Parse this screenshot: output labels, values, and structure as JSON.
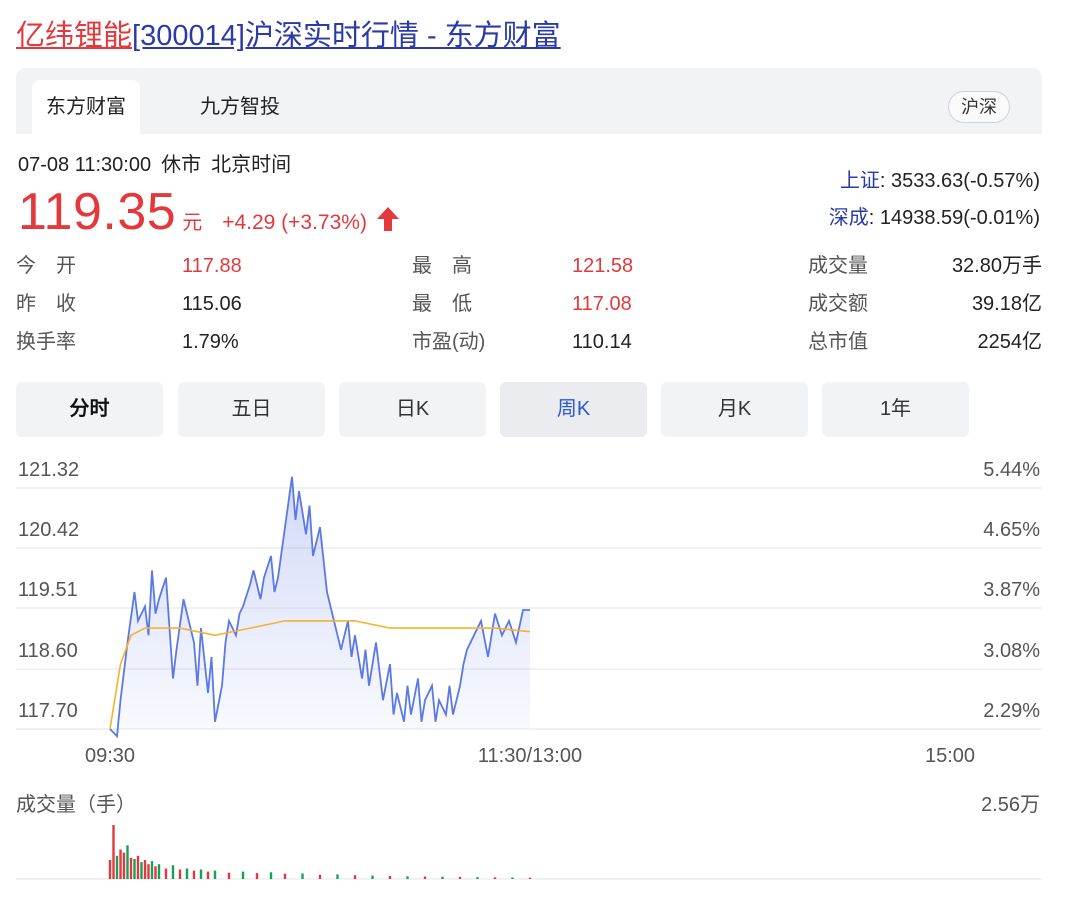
{
  "page_title": {
    "name": "亿纬锂能",
    "rest": "[300014]沪深实时行情 - 东方财富"
  },
  "tabs": [
    {
      "label": "东方财富",
      "active": true
    },
    {
      "label": "九方智投",
      "active": false
    }
  ],
  "market_badge": "沪深",
  "status": {
    "datetime": "07-08 11:30:00",
    "state": "休市",
    "timezone": "北京时间"
  },
  "price": {
    "value": "119.35",
    "unit": "元",
    "change": "+4.29 (+3.73%)",
    "direction": "up"
  },
  "indices": [
    {
      "label": "上证",
      "value": ": 3533.63(-0.57%)"
    },
    {
      "label": "深成",
      "value": ": 14938.59(-0.01%)"
    }
  ],
  "stats": [
    [
      {
        "label": "今　开",
        "value": "117.88",
        "red": true
      },
      {
        "label": "最　高",
        "value": "121.58",
        "red": true
      },
      {
        "label": "成交量",
        "value": "32.80万手",
        "red": false
      }
    ],
    [
      {
        "label": "昨　收",
        "value": "115.06",
        "red": false
      },
      {
        "label": "最　低",
        "value": "117.08",
        "red": true
      },
      {
        "label": "成交额",
        "value": "39.18亿",
        "red": false
      }
    ],
    [
      {
        "label": "换手率",
        "value": "1.79%",
        "red": false
      },
      {
        "label": "市盈(动)",
        "value": "110.14",
        "red": false
      },
      {
        "label": "总市值",
        "value": "2254亿",
        "red": false
      }
    ]
  ],
  "periods": [
    {
      "label": "分时",
      "state": "bold"
    },
    {
      "label": "五日",
      "state": ""
    },
    {
      "label": "日K",
      "state": ""
    },
    {
      "label": "周K",
      "state": "selected"
    },
    {
      "label": "月K",
      "state": ""
    },
    {
      "label": "1年",
      "state": ""
    }
  ],
  "volume_label": "成交量（手）",
  "volume_max_label": "2.56万",
  "colors": {
    "up": "#e4393c",
    "down": "#16a05d",
    "price_line": "#5b78e6",
    "avg_line": "#f5b230",
    "link": "#2b3aa8"
  },
  "chart_data": {
    "type": "line",
    "x_ticks": [
      "09:30",
      "11:30/13:00",
      "15:00"
    ],
    "y_left_ticks": [
      "121.32",
      "120.42",
      "119.51",
      "118.60",
      "117.70"
    ],
    "y_right_ticks": [
      "5.44%",
      "4.65%",
      "3.87%",
      "3.08%",
      "2.29%"
    ],
    "ylim": [
      117.7,
      121.32
    ],
    "x_total_minutes": 240,
    "series": [
      {
        "key": "price",
        "x": [
          0,
          2,
          3,
          5,
          7,
          8,
          10,
          11,
          12,
          13,
          14,
          16,
          17,
          18,
          19,
          21,
          22,
          24,
          25,
          26,
          28,
          29,
          30,
          32,
          33,
          34,
          36,
          37,
          38,
          40,
          41,
          43,
          44,
          46,
          47,
          48,
          50,
          52,
          53,
          54,
          56,
          57,
          58,
          60,
          62,
          64,
          65,
          66,
          68,
          69,
          70,
          72,
          73,
          74,
          76,
          77,
          78,
          80,
          81,
          82,
          84,
          85,
          86,
          88,
          89,
          90,
          92,
          93,
          94,
          96,
          97,
          98,
          100,
          101,
          102,
          104,
          106,
          108,
          110,
          112,
          114,
          116,
          118,
          120
        ],
        "values": [
          117.7,
          117.6,
          118.1,
          118.9,
          119.6,
          119.2,
          119.4,
          119.0,
          119.9,
          119.3,
          119.5,
          119.8,
          119.1,
          118.4,
          118.8,
          119.5,
          119.3,
          118.9,
          118.3,
          119.1,
          118.2,
          118.7,
          117.8,
          118.3,
          118.9,
          119.2,
          119.0,
          119.3,
          119.4,
          119.7,
          119.9,
          119.5,
          119.8,
          120.1,
          119.6,
          119.8,
          120.5,
          121.2,
          120.6,
          121.0,
          120.4,
          120.8,
          120.1,
          120.5,
          119.6,
          119.2,
          119.0,
          118.8,
          119.2,
          118.7,
          119.0,
          118.4,
          118.8,
          118.3,
          118.9,
          118.5,
          118.1,
          118.6,
          117.9,
          118.2,
          117.8,
          118.3,
          117.9,
          118.4,
          117.8,
          118.1,
          118.3,
          117.8,
          118.1,
          117.9,
          118.3,
          117.9,
          118.3,
          118.6,
          118.8,
          119.0,
          119.2,
          118.7,
          119.3,
          119.0,
          119.2,
          118.9,
          119.35,
          119.35
        ]
      },
      {
        "key": "avg",
        "x": [
          0,
          3,
          6,
          10,
          14,
          20,
          30,
          40,
          50,
          60,
          70,
          80,
          90,
          100,
          110,
          120
        ],
        "values": [
          117.7,
          118.6,
          119.0,
          119.1,
          119.1,
          119.1,
          119.0,
          119.1,
          119.2,
          119.2,
          119.2,
          119.1,
          119.1,
          119.1,
          119.1,
          119.05
        ]
      }
    ],
    "volume": {
      "max": 25600,
      "x": [
        0,
        1,
        2,
        3,
        4,
        5,
        6,
        7,
        8,
        9,
        10,
        11,
        12,
        13,
        14,
        16,
        18,
        20,
        22,
        24,
        26,
        28,
        30,
        34,
        38,
        42,
        46,
        50,
        55,
        60,
        65,
        70,
        75,
        80,
        85,
        90,
        95,
        100,
        105,
        110,
        115,
        120
      ],
      "values": [
        9000,
        25600,
        11000,
        14000,
        12500,
        16000,
        10000,
        9500,
        11000,
        8000,
        9000,
        7000,
        8500,
        6000,
        7000,
        5000,
        6500,
        4500,
        5000,
        4000,
        4500,
        3500,
        4000,
        3000,
        3500,
        2800,
        3200,
        2500,
        2600,
        2000,
        2200,
        1800,
        1600,
        1400,
        1300,
        1200,
        1100,
        1000,
        900,
        800,
        700,
        600
      ],
      "up": [
        true,
        true,
        false,
        true,
        true,
        false,
        true,
        false,
        true,
        false,
        true,
        true,
        false,
        true,
        false,
        true,
        false,
        true,
        false,
        true,
        false,
        true,
        false,
        true,
        false,
        true,
        false,
        true,
        false,
        true,
        false,
        true,
        false,
        true,
        false,
        true,
        false,
        true,
        false,
        true,
        false,
        true
      ]
    }
  }
}
